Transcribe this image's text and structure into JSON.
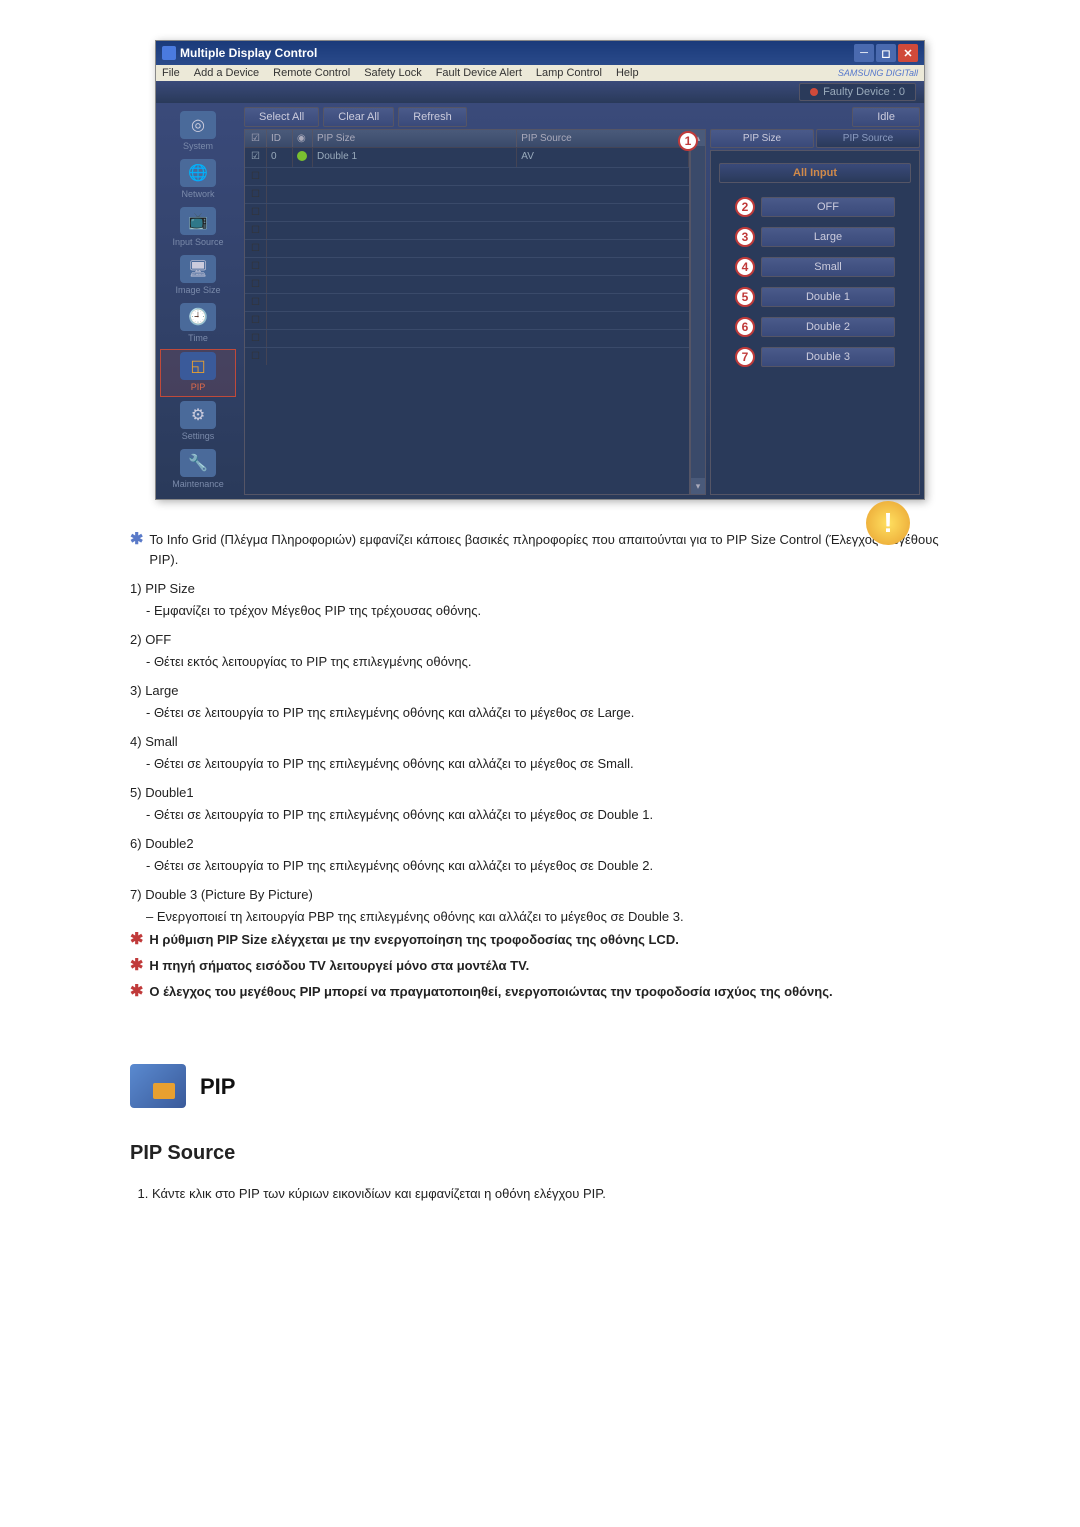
{
  "window": {
    "title": "Multiple Display Control",
    "menus": [
      "File",
      "Add a Device",
      "Remote Control",
      "Safety Lock",
      "Fault Device Alert",
      "Lamp Control",
      "Help"
    ],
    "brand": "SAMSUNG DIGITall",
    "faulty": "Faulty Device : 0"
  },
  "sidebar": {
    "items": [
      {
        "label": "System",
        "glyph": "◎"
      },
      {
        "label": "Network",
        "glyph": "🌐"
      },
      {
        "label": "Input Source",
        "glyph": "📺"
      },
      {
        "label": "Image Size",
        "glyph": "🖥"
      },
      {
        "label": "Time",
        "glyph": "🕘"
      },
      {
        "label": "PIP",
        "glyph": "◱"
      },
      {
        "label": "Settings",
        "glyph": "⚙"
      },
      {
        "label": "Maintenance",
        "glyph": "🔧"
      }
    ]
  },
  "toolbar": {
    "select_all": "Select All",
    "clear_all": "Clear All",
    "refresh": "Refresh",
    "idle": "Idle"
  },
  "grid": {
    "headers": {
      "id": "ID",
      "size": "PIP Size",
      "source": "PIP Source"
    },
    "row": {
      "id": "0",
      "size": "Double 1",
      "source": "AV"
    }
  },
  "panel": {
    "tabs": {
      "size": "PIP Size",
      "source": "PIP Source"
    },
    "all_input": "All Input",
    "options": [
      {
        "n": "2",
        "label": "OFF"
      },
      {
        "n": "3",
        "label": "Large"
      },
      {
        "n": "4",
        "label": "Small"
      },
      {
        "n": "5",
        "label": "Double 1"
      },
      {
        "n": "6",
        "label": "Double 2"
      },
      {
        "n": "7",
        "label": "Double 3"
      }
    ],
    "badge1": "1"
  },
  "doc": {
    "intro": "Το Info Grid (Πλέγμα Πληροφοριών) εμφανίζει κάποιες βασικές πληροφορίες που απαιτούνται για το PIP Size Control (Έλεγχος Μεγέθους PIP).",
    "items": [
      {
        "n": "1)",
        "t": "PIP Size",
        "d": "- Εμφανίζει το τρέχον Μέγεθος PIP της τρέχουσας οθόνης."
      },
      {
        "n": "2)",
        "t": "OFF",
        "d": "- Θέτει εκτός λειτουργίας το PIP της επιλεγμένης οθόνης."
      },
      {
        "n": "3)",
        "t": "Large",
        "d": "- Θέτει σε λειτουργία το PIP της επιλεγμένης οθόνης και αλλάζει το μέγεθος σε Large."
      },
      {
        "n": "4)",
        "t": "Small",
        "d": "- Θέτει σε λειτουργία το PIP της επιλεγμένης οθόνης και αλλάζει το μέγεθος σε Small."
      },
      {
        "n": "5)",
        "t": "Double1",
        "d": "- Θέτει σε λειτουργία το PIP της επιλεγμένης οθόνης και αλλάζει το μέγεθος σε Double 1."
      },
      {
        "n": "6)",
        "t": "Double2",
        "d": "- Θέτει σε λειτουργία το PIP της επιλεγμένης οθόνης και αλλάζει το μέγεθος σε Double 2."
      },
      {
        "n": "7)",
        "t": "Double 3 (Picture By Picture)",
        "d": "– Ενεργοποιεί τη λειτουργία PBP της επιλεγμένης οθόνης και αλλάζει το μέγεθος σε Double 3."
      }
    ],
    "notes": [
      "Η ρύθμιση PIP Size ελέγχεται με την ενεργοποίηση της τροφοδοσίας της οθόνης LCD.",
      "Η πηγή σήματος εισόδου TV λειτουργεί μόνο στα μοντέλα TV.",
      "Ο έλεγχος του μεγέθους PIP μπορεί να πραγματοποιηθεί, ενεργοποιώντας την τροφοδοσία ισχύος της οθόνης."
    ],
    "pip_heading": "PIP",
    "pip_source": "PIP Source",
    "pip_step1": "Κάντε κλικ στο PIP των κύριων εικονιδίων και εμφανίζεται η οθόνη ελέγχου PIP."
  }
}
